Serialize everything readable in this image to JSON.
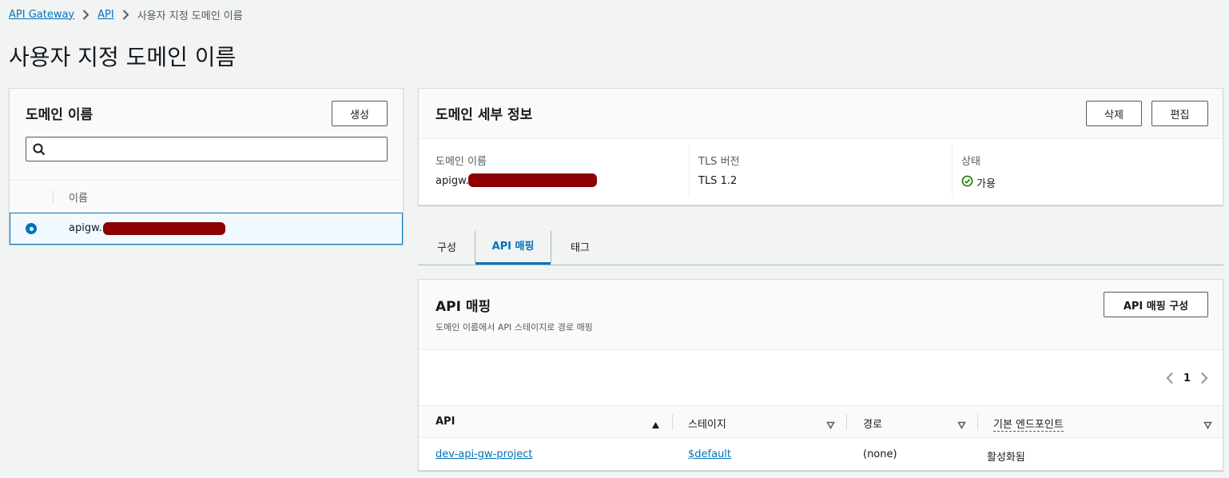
{
  "breadcrumb": {
    "items": [
      "API Gateway",
      "API"
    ],
    "current": "사용자 지정 도메인 이름"
  },
  "page": {
    "title": "사용자 지정 도메인 이름"
  },
  "left_panel": {
    "title": "도메인 이름",
    "create_label": "생성",
    "search_placeholder": "",
    "column_name": "이름",
    "rows": [
      {
        "name": "apigw.",
        "selected": true
      }
    ]
  },
  "details": {
    "title": "도메인 세부 정보",
    "delete_label": "삭제",
    "edit_label": "편집",
    "domain_name_label": "도메인 이름",
    "domain_name_value": "apigw.",
    "tls_label": "TLS 버전",
    "tls_value": "TLS 1.2",
    "status_label": "상태",
    "status_value": "가용"
  },
  "tabs": [
    {
      "label": "구성",
      "active": false
    },
    {
      "label": "API 매핑",
      "active": true
    },
    {
      "label": "태그",
      "active": false
    }
  ],
  "api_mapping": {
    "title": "API 매핑",
    "subtitle": "도메인 이름에서 API 스테이지로 경로 매핑",
    "configure_label": "API 매핑 구성",
    "page_number": "1",
    "columns": [
      "API",
      "스테이지",
      "경로",
      "기본 엔드포인트"
    ],
    "rows": [
      {
        "api": "dev-api-gw-project",
        "stage": "$default",
        "path": "(none)",
        "endpoint": "활성화됨"
      }
    ]
  },
  "colors": {
    "link": "#0073bb",
    "status_ok": "#1d8102",
    "redaction": "#8b0000"
  }
}
